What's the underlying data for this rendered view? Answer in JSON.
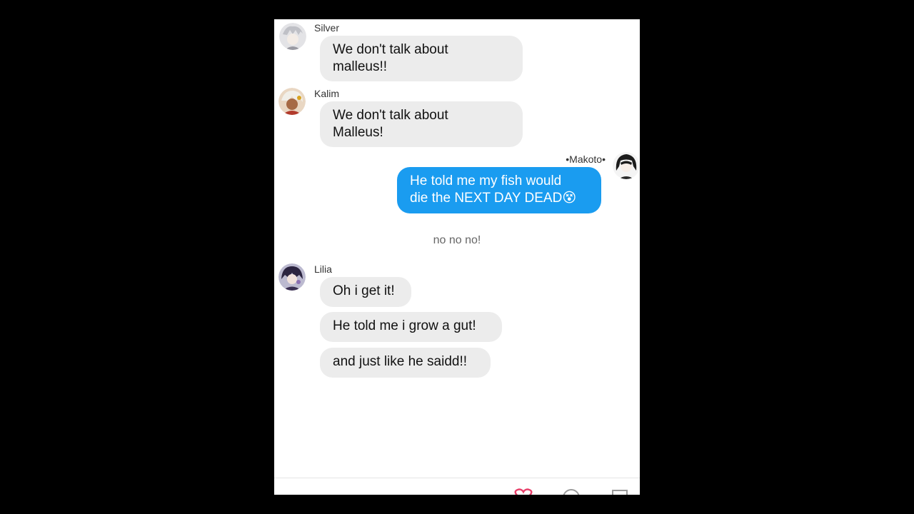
{
  "messages": [
    {
      "sender": "Silver",
      "text_lines": [
        "We don't talk about",
        "malleus!!"
      ]
    },
    {
      "sender": "Kalim",
      "text_lines": [
        "We don't talk about",
        "Malleus!"
      ]
    },
    {
      "sender": "•Makoto•",
      "text_lines": [
        "He told me my fish would",
        "die the NEXT DAY DEAD😵"
      ]
    },
    {
      "system": "no no no!"
    },
    {
      "sender": "Lilia",
      "texts": [
        "Oh i get it!",
        "He told me i grow a gut!",
        "and just like he saidd!!"
      ]
    }
  ],
  "colors": {
    "outgoing": "#1a9cf0",
    "incoming": "#ececec",
    "background": "#ffffff"
  },
  "icons": [
    "heart-icon",
    "chat-icon",
    "share-icon"
  ]
}
